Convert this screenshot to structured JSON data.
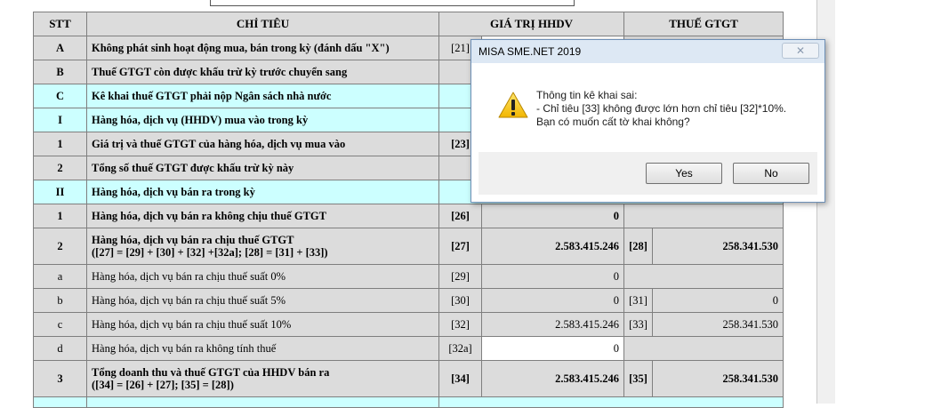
{
  "table": {
    "headers": {
      "stt": "STT",
      "chi_tieu": "CHỈ TIÊU",
      "gia_tri": "GIÁ TRỊ HHDV",
      "thue": "THUẾ GTGT"
    },
    "rows": [
      {
        "stt": "A",
        "desc": "Không phát sinh hoạt động mua, bán trong kỳ (đánh dấu \"X\")",
        "code1": "[21]"
      },
      {
        "stt": "B",
        "desc": "Thuế GTGT còn được khấu trừ kỳ trước chuyển sang"
      },
      {
        "stt": "C",
        "desc": "Kê khai thuế GTGT phải nộp Ngân sách nhà nước"
      },
      {
        "stt": "I",
        "desc": "Hàng hóa, dịch vụ (HHDV) mua vào trong kỳ"
      },
      {
        "stt": "1",
        "desc": "Giá trị và thuế GTGT của hàng hóa, dịch vụ mua vào",
        "code1": "[23]"
      },
      {
        "stt": "2",
        "desc": "Tổng số thuế GTGT  được khấu trừ kỳ này"
      },
      {
        "stt": "II",
        "desc": "Hàng hóa, dịch vụ bán ra trong kỳ"
      },
      {
        "stt": "1",
        "desc": "Hàng hóa, dịch vụ bán ra không chịu thuế GTGT",
        "code1": "[26]",
        "val1": "0"
      },
      {
        "stt": "2",
        "desc": "Hàng hóa, dịch vụ bán ra chịu thuế GTGT",
        "desc2": "([27] = [29] + [30] + [32] +[32a]; [28] = [31] + [33])",
        "code1": "[27]",
        "val1": "2.583.415.246",
        "code2": "[28]",
        "val2": "258.341.530"
      },
      {
        "stt": "a",
        "desc": "Hàng hóa, dịch vụ bán ra chịu thuế suất 0%",
        "code1": "[29]",
        "val1": "0"
      },
      {
        "stt": "b",
        "desc": "Hàng hóa, dịch vụ bán ra chịu thuế suất 5%",
        "code1": "[30]",
        "val1": "0",
        "code2": "[31]",
        "val2": "0"
      },
      {
        "stt": "c",
        "desc": "Hàng hóa, dịch vụ bán ra chịu thuế suất 10%",
        "code1": "[32]",
        "val1": "2.583.415.246",
        "code2": "[33]",
        "val2": "258.341.530"
      },
      {
        "stt": "d",
        "desc": "Hàng hóa, dịch vụ bán ra không tính thuế",
        "code1": "[32a]",
        "val1": "0"
      },
      {
        "stt": "3",
        "desc": "Tổng doanh thu và thuế GTGT của HHDV bán   ra",
        "desc2": "([34] = [26] + [27]; [35] = [28])",
        "code1": "[34]",
        "val1": "2.583.415.246",
        "code2": "[35]",
        "val2": "258.341.530"
      }
    ]
  },
  "dialog": {
    "title": "MISA SME.NET 2019",
    "close_icon": "close-icon",
    "icon": "warning-icon",
    "message_lines": [
      "Thông tin kê khai sai:",
      "- Chỉ tiêu [33] không được lớn hơn chỉ tiêu [32]*10%.",
      "Bạn có muốn cất tờ khai không?"
    ],
    "yes_label": "Yes",
    "no_label": "No"
  },
  "colors": {
    "header_gray": "#dcdcdc",
    "section_cyan": "#ccffff",
    "dialog_title": "#dde8f4"
  }
}
